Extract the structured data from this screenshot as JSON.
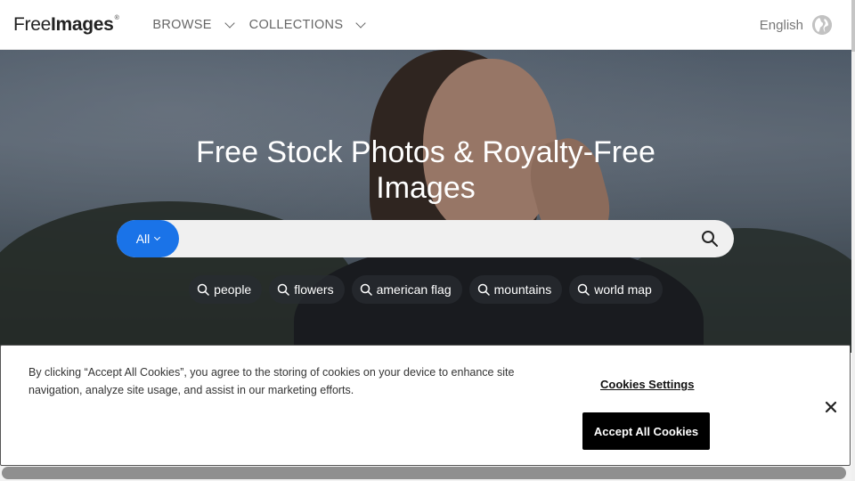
{
  "header": {
    "logo": {
      "part1": "Free",
      "part2": "Images",
      "mark": "®"
    },
    "nav": [
      {
        "label": "BROWSE"
      },
      {
        "label": "COLLECTIONS"
      }
    ],
    "language": "English"
  },
  "hero": {
    "title_line1": "Free Stock Photos & Royalty-Free",
    "title_line2": "Images",
    "search": {
      "category": "All",
      "placeholder": "",
      "value": ""
    },
    "tags": [
      "people",
      "flowers",
      "american flag",
      "mountains",
      "world map"
    ]
  },
  "cookie_banner": {
    "text": "By clicking “Accept All Cookies”, you agree to the storing of cookies on your device to enhance site navigation, analyze site usage, and assist in our marketing efforts.",
    "settings_label": "Cookies Settings",
    "accept_label": "Accept All Cookies"
  },
  "colors": {
    "accent": "#1a73e8",
    "accept_button": "#000000"
  }
}
